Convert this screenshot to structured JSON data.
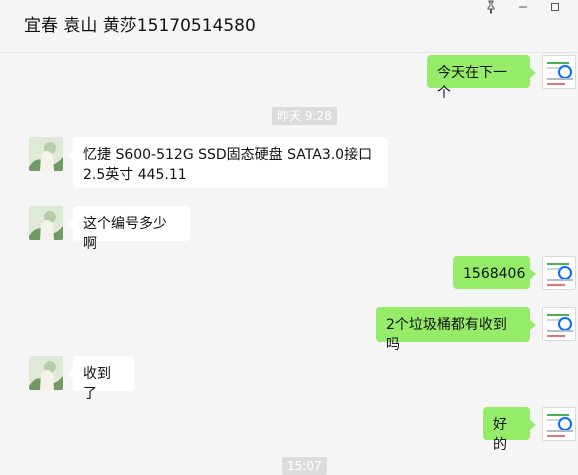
{
  "header": {
    "title": "宜春 袁山 黄莎15170514580",
    "pin_icon": "pin-icon",
    "minimize_icon": "minimize-icon",
    "maximize_icon": "maximize-icon"
  },
  "messages": [
    {
      "side": "right",
      "text": "今天在下一个"
    },
    {
      "side": "timestamp",
      "text": "昨天 9:28"
    },
    {
      "side": "left",
      "text_line1": "忆捷  S600-512G  SSD固态硬盘  SATA3.0接口",
      "text_line2": "2.5英寸      445.11"
    },
    {
      "side": "left",
      "text": "这个编号多少啊"
    },
    {
      "side": "right",
      "text": "1568406"
    },
    {
      "side": "right",
      "text": "2个垃圾桶都有收到吗"
    },
    {
      "side": "left",
      "text": "收到了"
    },
    {
      "side": "right",
      "text": "好的"
    },
    {
      "side": "timestamp",
      "text": "15:07"
    }
  ]
}
